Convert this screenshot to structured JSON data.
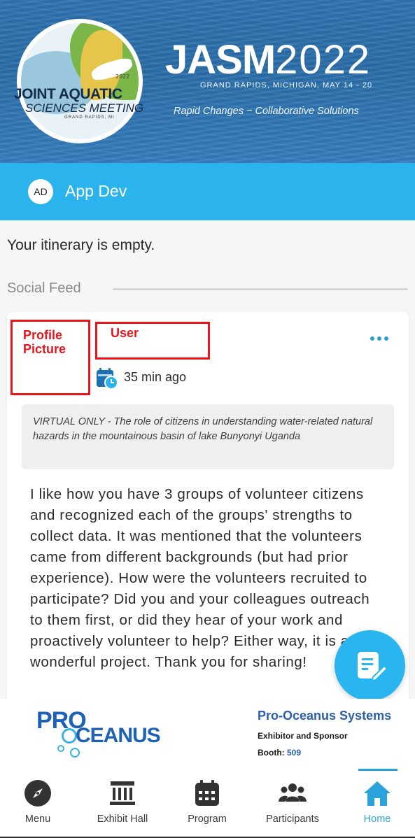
{
  "banner": {
    "logo_year": "2022",
    "logo_line1": "JOINT AQUATIC",
    "logo_line2": "SCIENCES MEETING",
    "logo_location": "GRAND RAPIDS, MI",
    "title_bold": "JASM",
    "title_year": "2022",
    "subtitle": "GRAND RAPIDS, MICHIGAN, MAY 14 - 20",
    "tagline": "Rapid Changes ~ Collaborative Solutions"
  },
  "user": {
    "initials": "AD",
    "name": "App Dev"
  },
  "itinerary": {
    "message": "Your itinerary is empty."
  },
  "feed": {
    "label": "Social Feed",
    "post": {
      "profile_picture_label": "Profile Picture",
      "user_label": "User",
      "time": "35 min ago",
      "session_title": "VIRTUAL ONLY - The role of citizens in understanding water-related natural hazards in the mountainous basin of lake Bunyonyi Uganda",
      "body": "I like how you have 3 groups of volunteer citizens and recognized each of the groups' strengths to collect data. It was mentioned that the volunteers came from different backgrounds (but had prior experience). How were the volunteers recruited to participate? Did you and your colleagues outreach to them first, or did they hear of your work and proactively volunteer to help? Either way, it is a wonderful project. Thank you for sharing!"
    }
  },
  "sponsor": {
    "logo_pro": "PRO",
    "logo_oceanus": "CEANUS",
    "name": "Pro-Oceanus Systems",
    "role": "Exhibitor and Sponsor",
    "booth_label": "Booth:",
    "booth_number": "509"
  },
  "nav": {
    "items": [
      {
        "label": "Menu",
        "icon": "compass-icon"
      },
      {
        "label": "Exhibit Hall",
        "icon": "building-icon"
      },
      {
        "label": "Program",
        "icon": "calendar-icon"
      },
      {
        "label": "Participants",
        "icon": "people-icon"
      },
      {
        "label": "Home",
        "icon": "home-icon"
      }
    ],
    "active": "Home"
  },
  "colors": {
    "accent": "#2ab3ec",
    "nav_active": "#2aa3dc",
    "annotation_red": "#e8151b"
  }
}
